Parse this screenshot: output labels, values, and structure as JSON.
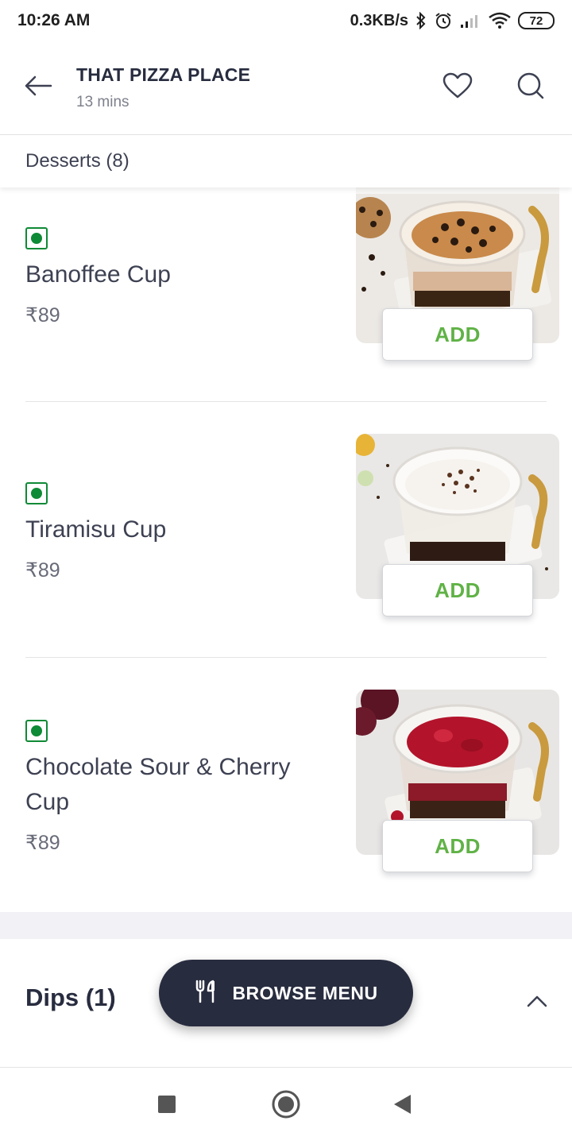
{
  "status_bar": {
    "time": "10:26 AM",
    "network_speed": "0.3KB/s",
    "battery": "72",
    "icons": [
      "bluetooth-icon",
      "alarm-icon",
      "signal-icon",
      "wifi-icon",
      "battery-icon"
    ]
  },
  "header": {
    "restaurant_name": "THAT PIZZA PLACE",
    "eta": "13 mins",
    "icons": [
      "back-arrow-icon",
      "heart-icon",
      "search-icon"
    ]
  },
  "section": {
    "title": "Desserts (8)"
  },
  "items": [
    {
      "name": "Banoffee Cup",
      "price": "₹89",
      "add_label": "ADD",
      "veg": true,
      "photo_colors": [
        "#c98a4b",
        "#f3ede4",
        "#3a2414"
      ]
    },
    {
      "name": "Tiramisu Cup",
      "price": "₹89",
      "add_label": "ADD",
      "veg": true,
      "photo_colors": [
        "#f6f3ee",
        "#5a3420",
        "#2e1c14"
      ]
    },
    {
      "name": "Chocolate Sour & Cherry Cup",
      "price": "₹89",
      "add_label": "ADD",
      "veg": true,
      "photo_colors": [
        "#b3142b",
        "#ece8e4",
        "#3b2216"
      ]
    }
  ],
  "next_section": {
    "title": "Dips (1)"
  },
  "browse_menu": {
    "label": "BROWSE MENU",
    "icon": "cutlery-icon"
  },
  "colors": {
    "veg_green": "#0f8a36",
    "add_green": "#60b246",
    "dark_navy": "#282c3f"
  },
  "nav_bar": {
    "icons": [
      "recents-square-icon",
      "home-circle-icon",
      "back-triangle-icon"
    ]
  }
}
